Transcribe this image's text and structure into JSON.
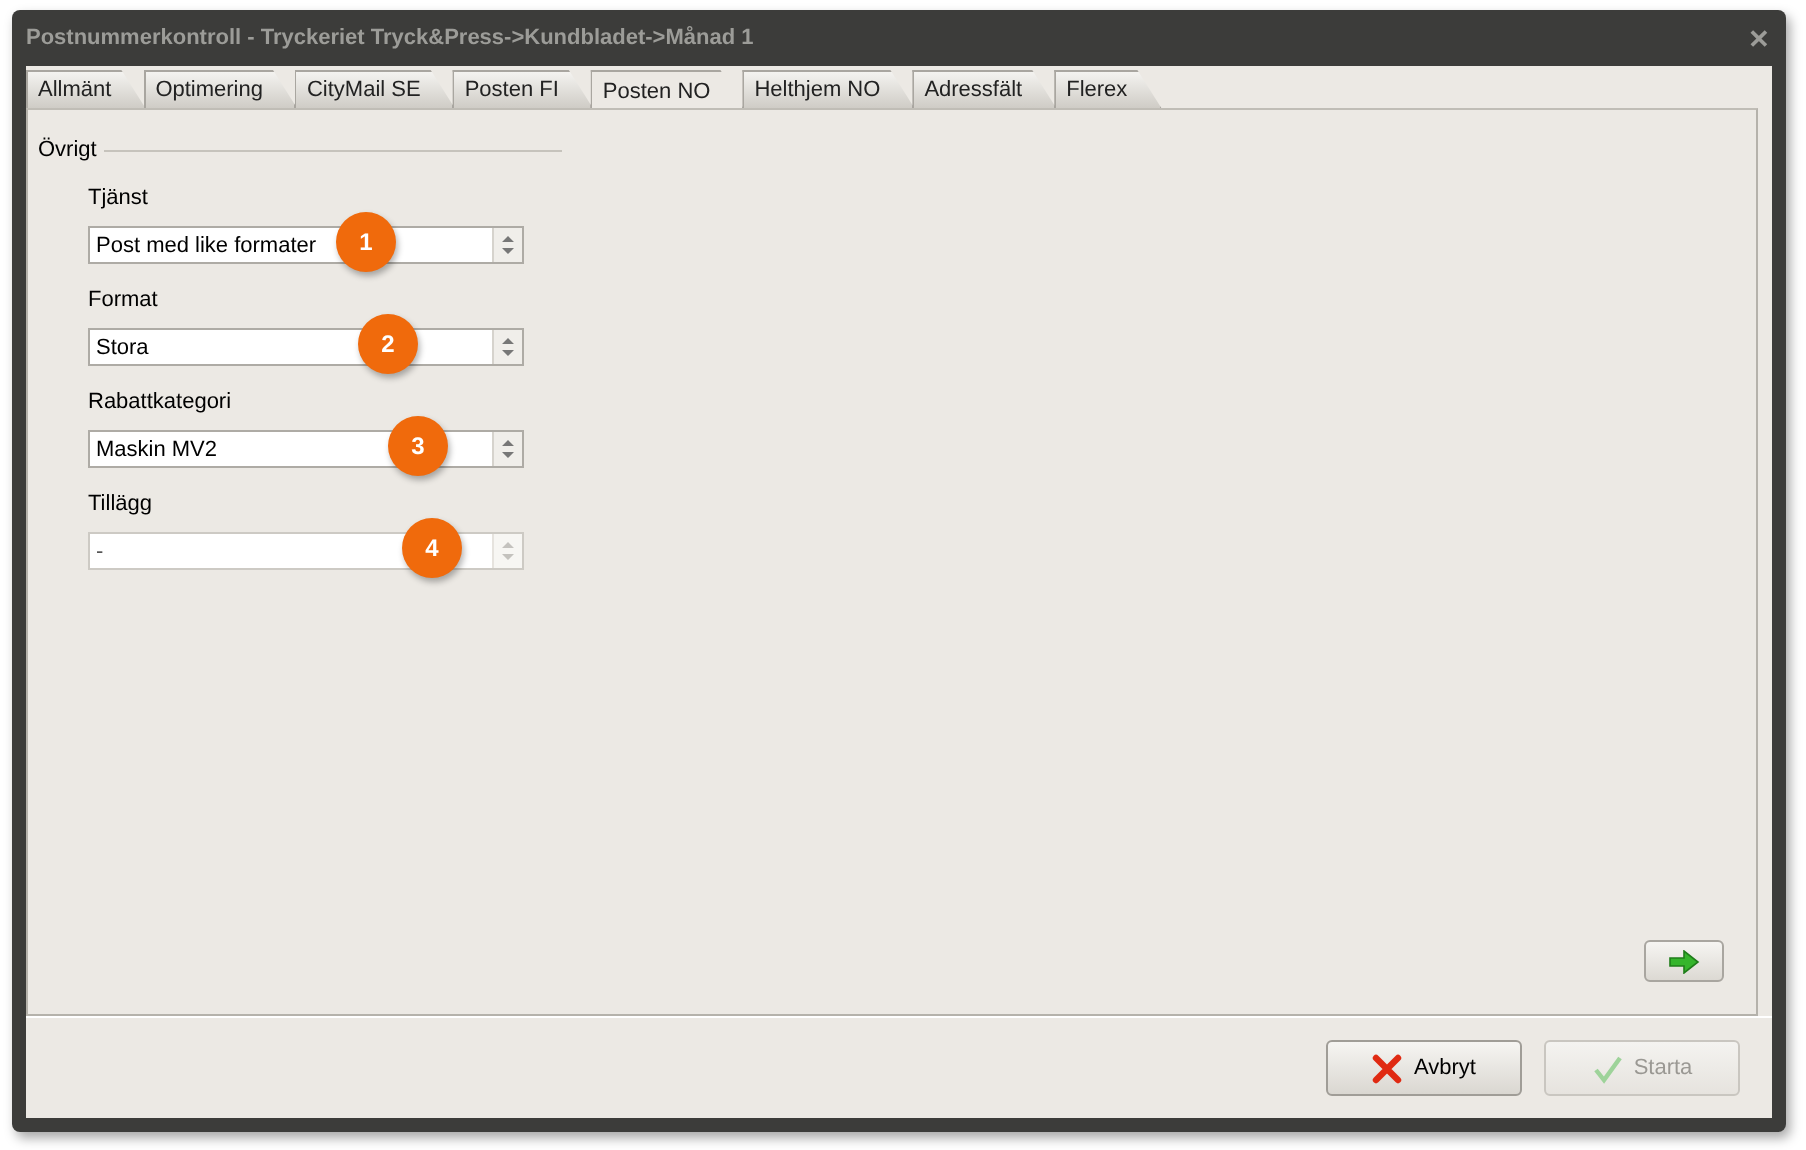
{
  "window": {
    "title": "Postnummerkontroll - Tryckeriet Tryck&Press->Kundbladet->Månad 1",
    "close": "✕"
  },
  "tabs": [
    {
      "label": "Allmänt",
      "selected": false
    },
    {
      "label": "Optimering",
      "selected": false
    },
    {
      "label": "CityMail SE",
      "selected": false
    },
    {
      "label": "Posten FI",
      "selected": false
    },
    {
      "label": "Posten NO",
      "selected": true
    },
    {
      "label": "Helthjem NO",
      "selected": false
    },
    {
      "label": "Adressfält",
      "selected": false
    },
    {
      "label": "Flerex",
      "selected": false
    }
  ],
  "group": {
    "title": "Övrigt",
    "fields": [
      {
        "label": "Tjänst",
        "value": "Post med like formater",
        "disabled": false,
        "badge": "1"
      },
      {
        "label": "Format",
        "value": "Stora",
        "disabled": false,
        "badge": "2"
      },
      {
        "label": "Rabattkategori",
        "value": "Maskin MV2",
        "disabled": false,
        "badge": "3"
      },
      {
        "label": "Tillägg",
        "value": "-",
        "disabled": true,
        "badge": "4"
      }
    ]
  },
  "buttons": [
    {
      "label": "Avbryt",
      "kind": "cancel",
      "disabled": false
    },
    {
      "label": "Starta",
      "kind": "start",
      "disabled": true
    }
  ]
}
